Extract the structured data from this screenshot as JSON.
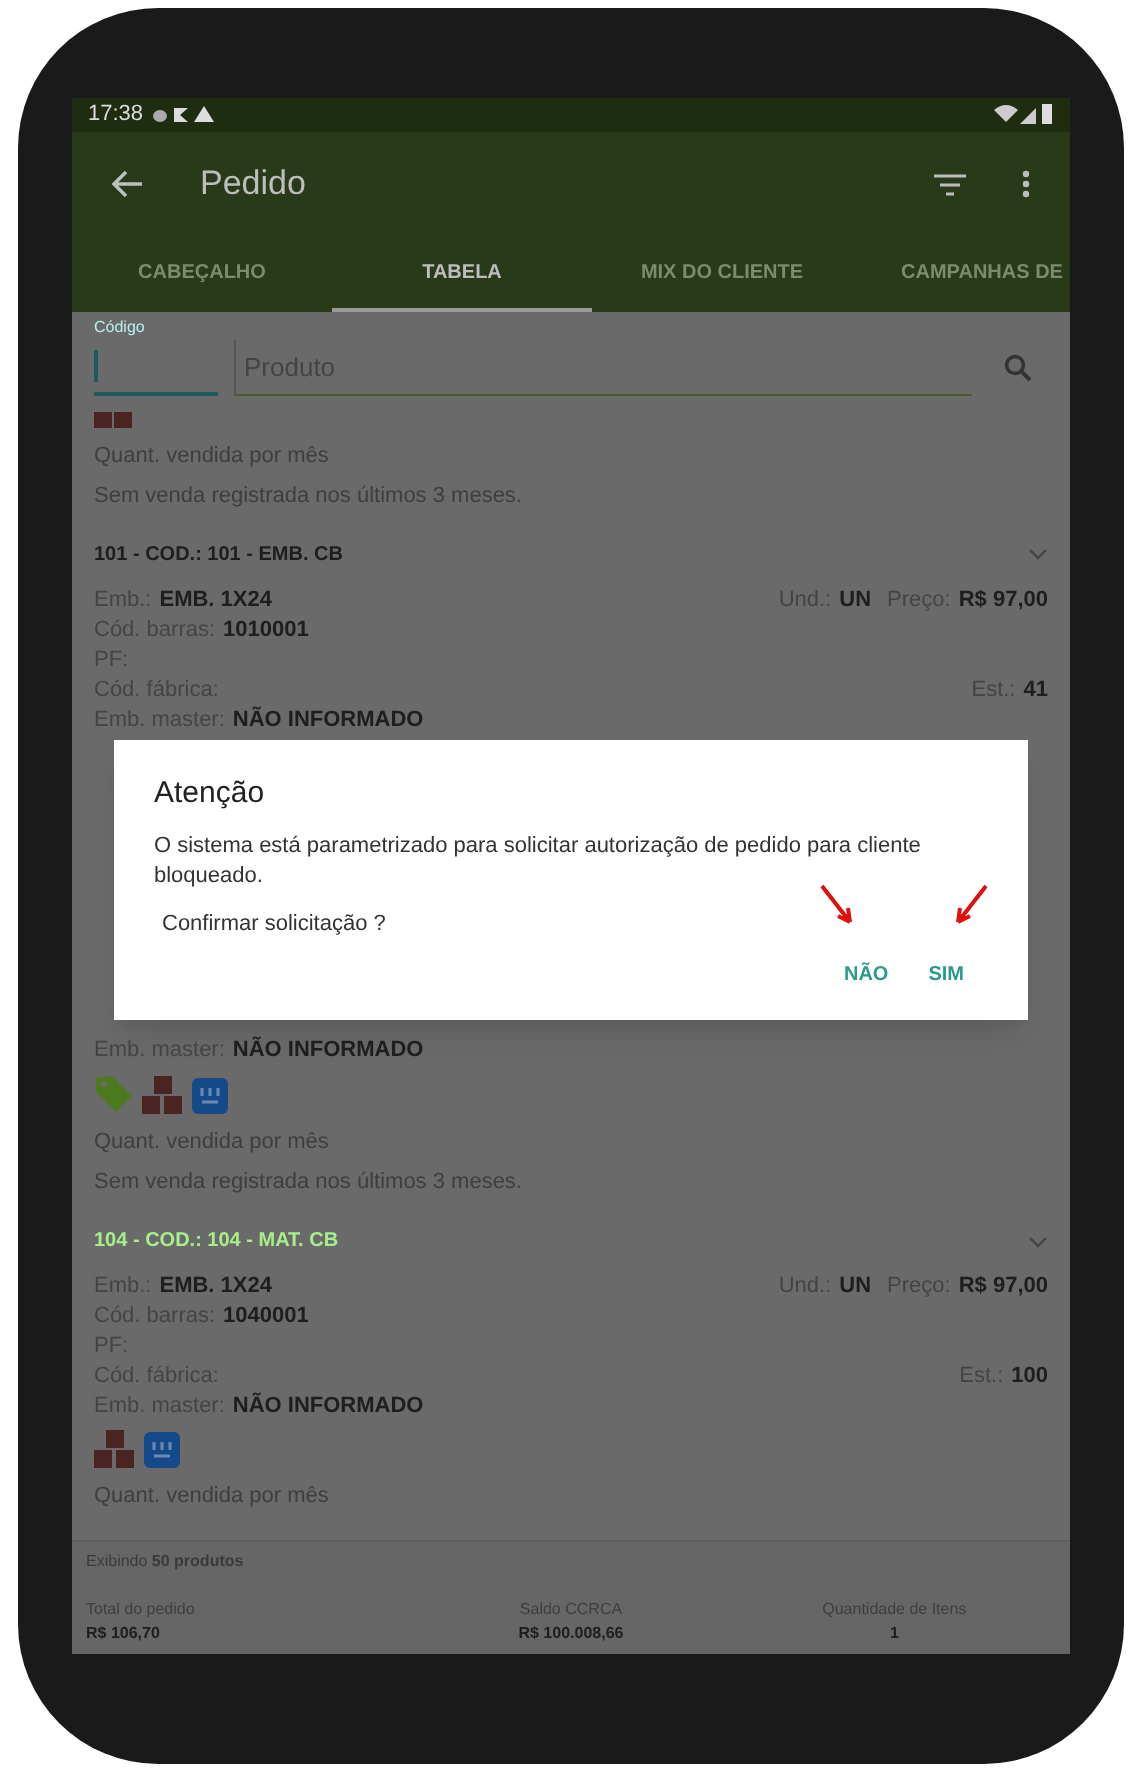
{
  "status_bar": {
    "time": "17:38"
  },
  "toolbar": {
    "title": "Pedido"
  },
  "tabs": [
    {
      "label": "CABEÇALHO",
      "selected": false
    },
    {
      "label": "TABELA",
      "selected": true
    },
    {
      "label": "MIX DO CLIENTE",
      "selected": false
    },
    {
      "label": "CAMPANHAS DE",
      "selected": false
    }
  ],
  "search": {
    "code_label": "Código",
    "product_placeholder": "Produto"
  },
  "rows_above": [
    {
      "kind": "icons",
      "icons": [
        {
          "kind": "boxes-small"
        }
      ]
    },
    {
      "kind": "note",
      "text": "Quant. vendida por mês"
    },
    {
      "kind": "note",
      "text": "Sem venda registrada nos últimos 3 meses."
    },
    {
      "kind": "header",
      "text": "101 - COD.: 101 - EMB. CB",
      "highlighted": false
    },
    {
      "kind": "field",
      "label": "Emb.:",
      "value": "EMB. 1X24",
      "right": [
        {
          "label": "Und.:",
          "value": "UN"
        },
        {
          "label": "Preço:",
          "value": "R$ 97,00"
        }
      ]
    },
    {
      "kind": "field",
      "label": "Cód. barras:",
      "value": "1010001"
    },
    {
      "kind": "field",
      "label": "PF:"
    },
    {
      "kind": "field",
      "label": "Cód. fábrica:",
      "right": [
        {
          "label": "Est.:",
          "value": "41"
        }
      ]
    },
    {
      "kind": "field",
      "label": "Emb. master:",
      "value": "NÃO INFORMADO"
    }
  ],
  "dialog": {
    "title": "Atenção",
    "message": "O sistema está parametrizado para solicitar autorização de pedido para cliente bloqueado.",
    "question": "Confirmar solicitação ?",
    "buttons": [
      "NÃO",
      "SIM"
    ]
  },
  "rows_below": [
    {
      "kind": "field",
      "label": "Emb. master:",
      "value": "NÃO INFORMADO"
    },
    {
      "kind": "icons",
      "icons": [
        {
          "kind": "tag"
        },
        {
          "kind": "boxes"
        },
        {
          "kind": "package"
        }
      ]
    },
    {
      "kind": "note",
      "text": "Quant. vendida por mês"
    },
    {
      "kind": "note",
      "text": "Sem venda registrada nos últimos 3 meses."
    },
    {
      "kind": "header",
      "text": "104 - COD.: 104 - MAT. CB",
      "highlighted": true
    },
    {
      "kind": "field",
      "label": "Emb.:",
      "value": "EMB. 1X24",
      "right": [
        {
          "label": "Und.:",
          "value": "UN"
        },
        {
          "label": "Preço:",
          "value": "R$ 97,00"
        }
      ]
    },
    {
      "kind": "field",
      "label": "Cód. barras:",
      "value": "1040001"
    },
    {
      "kind": "field",
      "label": "PF:"
    },
    {
      "kind": "field",
      "label": "Cód. fábrica:",
      "right": [
        {
          "label": "Est.:",
          "value": "100"
        }
      ]
    },
    {
      "kind": "field",
      "label": "Emb. master:",
      "value": "NÃO INFORMADO"
    },
    {
      "kind": "icons",
      "icons": [
        {
          "kind": "boxes"
        },
        {
          "kind": "package"
        }
      ]
    },
    {
      "kind": "note",
      "text": "Quant. vendida por mês"
    }
  ],
  "footer": {
    "count": "Exibindo **50 produtos**",
    "totals": [
      {
        "label": "Total do pedido",
        "value": "R$ 106,70"
      },
      {
        "label": "Saldo CCRCA",
        "value": "R$ 100.008,66"
      },
      {
        "label": "Quantidade de Itens",
        "value": "1"
      }
    ]
  }
}
